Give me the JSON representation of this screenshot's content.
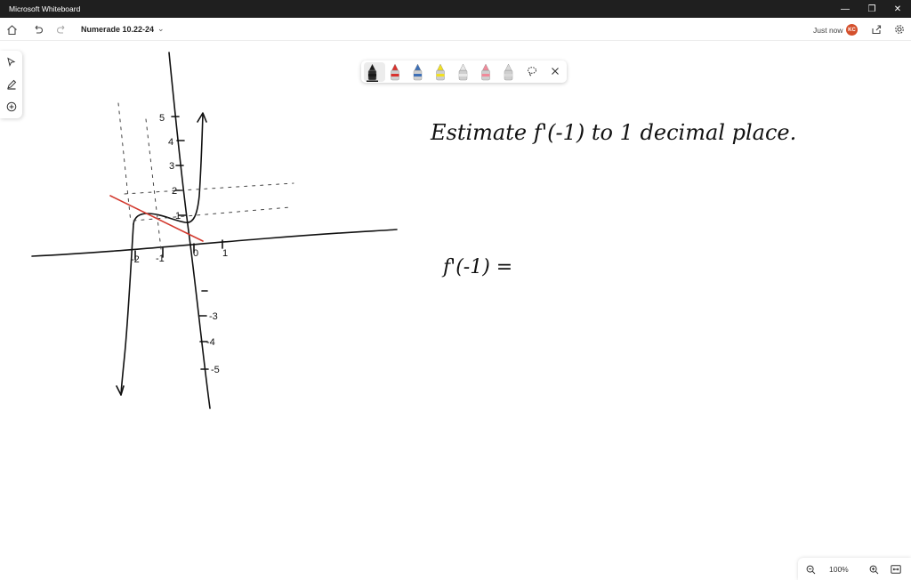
{
  "window": {
    "title": "Microsoft Whiteboard",
    "minimize_glyph": "—",
    "restore_glyph": "❐",
    "close_glyph": "✕"
  },
  "toolbar": {
    "home_icon": "home-icon",
    "undo_icon": "undo-icon",
    "redo_icon": "redo-icon",
    "board_name": "Numerade 10.22-24",
    "save_status": "Just now",
    "avatar_initials": "KC",
    "share_icon": "share-icon",
    "settings_icon": "gear-icon"
  },
  "left_rail": {
    "tools": [
      "select-icon",
      "ink-pen-icon",
      "add-icon"
    ]
  },
  "ink_toolbar": {
    "pens": [
      {
        "name": "black-pen",
        "color": "#1a1a1a"
      },
      {
        "name": "red-pen",
        "color": "#d9322e"
      },
      {
        "name": "blue-pen",
        "color": "#3d6fb6"
      },
      {
        "name": "yellow-highlighter",
        "color": "#f2e021"
      },
      {
        "name": "white-pen",
        "color": "#e8e8e8"
      },
      {
        "name": "pink-pen",
        "color": "#f08a9a"
      },
      {
        "name": "eraser",
        "color": "#d8d8d8"
      }
    ],
    "lasso_icon": "lasso-icon",
    "close_icon": "close-icon"
  },
  "canvas": {
    "prompt_text": "Estimate f'(-1) to 1 decimal place.",
    "answer_text": "f'(-1) =",
    "y_tick_labels": [
      "5",
      "4",
      "3",
      "2",
      "1",
      "-3",
      "-4",
      "-5"
    ],
    "x_tick_labels": [
      "-2",
      "-1",
      "0",
      "1"
    ],
    "ink_colors": {
      "graph": "#111111",
      "tangent": "#d33a2f",
      "guides": "#444444"
    }
  },
  "zoom": {
    "zoom_out_icon": "zoom-out-icon",
    "level": "100%",
    "zoom_in_icon": "zoom-in-icon",
    "fit_icon": "fit-screen-icon"
  }
}
